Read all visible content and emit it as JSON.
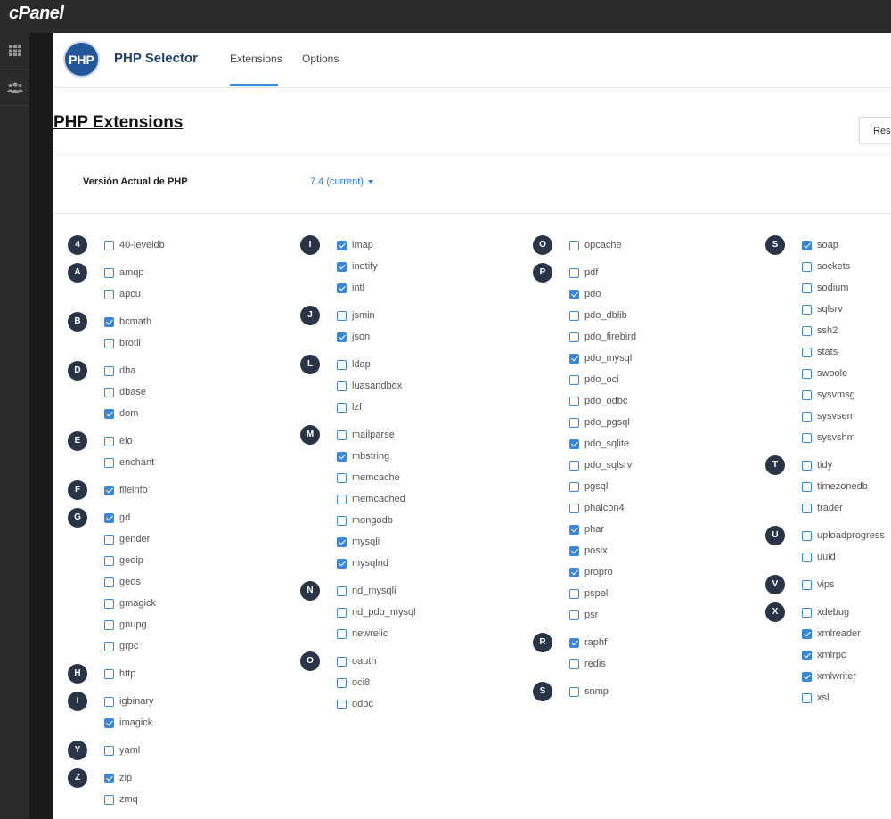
{
  "app": {
    "brand": "cPanel",
    "logo_text": "PHP",
    "title": "PHP Selector"
  },
  "tabs": [
    {
      "label": "Extensions",
      "active": true
    },
    {
      "label": "Options",
      "active": false
    }
  ],
  "page": {
    "title": "PHP Extensions",
    "reset_label": "Rese"
  },
  "version": {
    "label": "Versión Actual de PHP",
    "value": "7.4 (current)"
  },
  "colors": {
    "accent": "#3a86d8",
    "badge": "#293447",
    "topbar": "#2b2b2b",
    "brand_title": "#1d3f72"
  },
  "icons": {
    "sidebar": [
      "grid-icon",
      "users-icon"
    ]
  },
  "columns": [
    [
      {
        "letter": "4",
        "items": [
          {
            "name": "40-leveldb",
            "checked": false
          }
        ]
      },
      {
        "letter": "A",
        "items": [
          {
            "name": "amqp",
            "checked": false
          },
          {
            "name": "apcu",
            "checked": false
          }
        ]
      },
      {
        "letter": "B",
        "items": [
          {
            "name": "bcmath",
            "checked": true
          },
          {
            "name": "brotli",
            "checked": false
          }
        ]
      },
      {
        "letter": "D",
        "items": [
          {
            "name": "dba",
            "checked": false
          },
          {
            "name": "dbase",
            "checked": false
          },
          {
            "name": "dom",
            "checked": true
          }
        ]
      },
      {
        "letter": "E",
        "items": [
          {
            "name": "eio",
            "checked": false
          },
          {
            "name": "enchant",
            "checked": false
          }
        ]
      },
      {
        "letter": "F",
        "items": [
          {
            "name": "fileinfo",
            "checked": true
          }
        ]
      },
      {
        "letter": "G",
        "items": [
          {
            "name": "gd",
            "checked": true
          },
          {
            "name": "gender",
            "checked": false
          },
          {
            "name": "geoip",
            "checked": false
          },
          {
            "name": "geos",
            "checked": false
          },
          {
            "name": "gmagick",
            "checked": false
          },
          {
            "name": "gnupg",
            "checked": false
          },
          {
            "name": "grpc",
            "checked": false
          }
        ]
      },
      {
        "letter": "H",
        "items": [
          {
            "name": "http",
            "checked": false
          }
        ]
      },
      {
        "letter": "I",
        "items": [
          {
            "name": "igbinary",
            "checked": false
          },
          {
            "name": "imagick",
            "checked": true
          }
        ]
      },
      {
        "letter": "Y",
        "items": [
          {
            "name": "yaml",
            "checked": false
          }
        ]
      },
      {
        "letter": "Z",
        "items": [
          {
            "name": "zip",
            "checked": true
          },
          {
            "name": "zmq",
            "checked": false
          }
        ]
      }
    ],
    [
      {
        "letter": "I",
        "items": [
          {
            "name": "imap",
            "checked": true
          },
          {
            "name": "inotify",
            "checked": true
          },
          {
            "name": "intl",
            "checked": true
          }
        ]
      },
      {
        "letter": "J",
        "items": [
          {
            "name": "jsmin",
            "checked": false
          },
          {
            "name": "json",
            "checked": true
          }
        ]
      },
      {
        "letter": "L",
        "items": [
          {
            "name": "ldap",
            "checked": false
          },
          {
            "name": "luasandbox",
            "checked": false
          },
          {
            "name": "lzf",
            "checked": false
          }
        ]
      },
      {
        "letter": "M",
        "items": [
          {
            "name": "mailparse",
            "checked": false
          },
          {
            "name": "mbstring",
            "checked": true
          },
          {
            "name": "memcache",
            "checked": false
          },
          {
            "name": "memcached",
            "checked": false
          },
          {
            "name": "mongodb",
            "checked": false
          },
          {
            "name": "mysqli",
            "checked": true
          },
          {
            "name": "mysqlnd",
            "checked": true
          }
        ]
      },
      {
        "letter": "N",
        "items": [
          {
            "name": "nd_mysqli",
            "checked": false
          },
          {
            "name": "nd_pdo_mysql",
            "checked": false
          },
          {
            "name": "newrelic",
            "checked": false
          }
        ]
      },
      {
        "letter": "O",
        "items": [
          {
            "name": "oauth",
            "checked": false
          },
          {
            "name": "oci8",
            "checked": false
          },
          {
            "name": "odbc",
            "checked": false
          }
        ]
      }
    ],
    [
      {
        "letter": "O",
        "items": [
          {
            "name": "opcache",
            "checked": false
          }
        ]
      },
      {
        "letter": "P",
        "items": [
          {
            "name": "pdf",
            "checked": false
          },
          {
            "name": "pdo",
            "checked": true
          },
          {
            "name": "pdo_dblib",
            "checked": false
          },
          {
            "name": "pdo_firebird",
            "checked": false
          },
          {
            "name": "pdo_mysql",
            "checked": true
          },
          {
            "name": "pdo_oci",
            "checked": false
          },
          {
            "name": "pdo_odbc",
            "checked": false
          },
          {
            "name": "pdo_pgsql",
            "checked": false
          },
          {
            "name": "pdo_sqlite",
            "checked": true
          },
          {
            "name": "pdo_sqlsrv",
            "checked": false
          },
          {
            "name": "pgsql",
            "checked": false
          },
          {
            "name": "phalcon4",
            "checked": false
          },
          {
            "name": "phar",
            "checked": true
          },
          {
            "name": "posix",
            "checked": true
          },
          {
            "name": "propro",
            "checked": true
          },
          {
            "name": "pspell",
            "checked": false
          },
          {
            "name": "psr",
            "checked": false
          }
        ]
      },
      {
        "letter": "R",
        "items": [
          {
            "name": "raphf",
            "checked": true
          },
          {
            "name": "redis",
            "checked": false
          }
        ]
      },
      {
        "letter": "S",
        "items": [
          {
            "name": "snmp",
            "checked": false
          }
        ]
      }
    ],
    [
      {
        "letter": "S",
        "items": [
          {
            "name": "soap",
            "checked": true
          },
          {
            "name": "sockets",
            "checked": false
          },
          {
            "name": "sodium",
            "checked": false
          },
          {
            "name": "sqlsrv",
            "checked": false
          },
          {
            "name": "ssh2",
            "checked": false
          },
          {
            "name": "stats",
            "checked": false
          },
          {
            "name": "swoole",
            "checked": false
          },
          {
            "name": "sysvmsg",
            "checked": false
          },
          {
            "name": "sysvsem",
            "checked": false
          },
          {
            "name": "sysvshm",
            "checked": false
          }
        ]
      },
      {
        "letter": "T",
        "items": [
          {
            "name": "tidy",
            "checked": false
          },
          {
            "name": "timezonedb",
            "checked": false
          },
          {
            "name": "trader",
            "checked": false
          }
        ]
      },
      {
        "letter": "U",
        "items": [
          {
            "name": "uploadprogress",
            "checked": false
          },
          {
            "name": "uuid",
            "checked": false
          }
        ]
      },
      {
        "letter": "V",
        "items": [
          {
            "name": "vips",
            "checked": false
          }
        ]
      },
      {
        "letter": "X",
        "items": [
          {
            "name": "xdebug",
            "checked": false
          },
          {
            "name": "xmlreader",
            "checked": true
          },
          {
            "name": "xmlrpc",
            "checked": true
          },
          {
            "name": "xmlwriter",
            "checked": true
          },
          {
            "name": "xsl",
            "checked": false
          }
        ]
      }
    ]
  ]
}
